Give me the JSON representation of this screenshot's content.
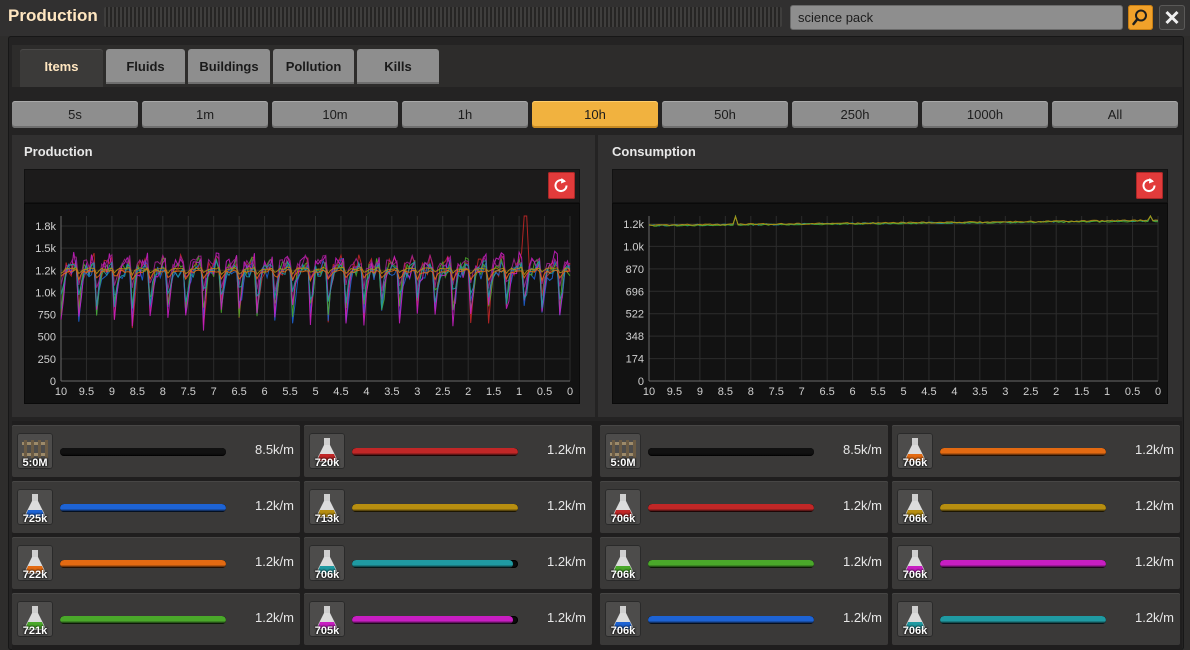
{
  "window": {
    "title": "Production"
  },
  "search": {
    "value": "science pack"
  },
  "tabs": [
    "Items",
    "Fluids",
    "Buildings",
    "Pollution",
    "Kills"
  ],
  "time_ranges": [
    "5s",
    "1m",
    "10m",
    "1h",
    "10h",
    "50h",
    "250h",
    "1000h",
    "All"
  ],
  "selected_time_range": "10h",
  "colors": {
    "accent": "#f1b23f",
    "reset": "#e23b3b",
    "series": [
      "#c12727",
      "#1d63d4",
      "#e36a12",
      "#4aa82a",
      "#a0208f",
      "#b78e10",
      "#1f9aa2",
      "#c81ec2",
      "#eeeeee"
    ]
  },
  "panels": {
    "production": {
      "title": "Production",
      "chart_data": {
        "type": "line",
        "title": "Production",
        "xlabel": "",
        "ylabel": "",
        "x_ticks": [
          "10",
          "9.5",
          "9",
          "8.5",
          "8",
          "7.5",
          "7",
          "6.5",
          "6",
          "5.5",
          "5",
          "4.5",
          "4",
          "3.5",
          "3",
          "2.5",
          "2",
          "1.5",
          "1",
          "0.5",
          "0"
        ],
        "y_ticks": [
          "0",
          "250",
          "500",
          "750",
          "1.0k",
          "1.2k",
          "1.5k",
          "1.8k"
        ],
        "ylim": [
          0,
          1750
        ],
        "xlim": [
          10,
          0
        ],
        "series": [
          {
            "color": "#c12727",
            "base": 1200,
            "amp": 550
          },
          {
            "color": "#1d63d4",
            "base": 1150,
            "amp": 500
          },
          {
            "color": "#4aa82a",
            "base": 1180,
            "amp": 480
          },
          {
            "color": "#c81ec2",
            "base": 1200,
            "amp": 600
          },
          {
            "color": "#a0208f",
            "base": 1250,
            "amp": 300
          },
          {
            "color": "#1f9aa2",
            "base": 1170,
            "amp": 380
          },
          {
            "color": "#e36a12",
            "base": 1160,
            "amp": 90
          },
          {
            "color": "#b78e10",
            "base": 1190,
            "amp": 60
          }
        ]
      }
    },
    "consumption": {
      "title": "Consumption",
      "chart_data": {
        "type": "line",
        "title": "Consumption",
        "xlabel": "",
        "ylabel": "",
        "x_ticks": [
          "10",
          "9.5",
          "9",
          "8.5",
          "8",
          "7.5",
          "7",
          "6.5",
          "6",
          "5.5",
          "5",
          "4.5",
          "4",
          "3.5",
          "3",
          "2.5",
          "2",
          "1.5",
          "1",
          "0.5",
          "0"
        ],
        "y_ticks": [
          "0",
          "174",
          "348",
          "522",
          "696",
          "870",
          "1.0k",
          "1.2k"
        ],
        "ylim": [
          0,
          1220
        ],
        "xlim": [
          10,
          0
        ],
        "series": [
          {
            "color": "#1f9aa2",
            "start": 1150,
            "end": 1185,
            "noise": 12
          },
          {
            "color": "#4aa82a",
            "start": 1148,
            "end": 1182,
            "noise": 10
          },
          {
            "color": "#b78e10",
            "start": 1152,
            "end": 1188,
            "noise": 10
          }
        ]
      }
    }
  },
  "production_rows": [
    {
      "icon": "rail-icon",
      "count": "5:0M",
      "color": "#111111",
      "fill": 1.0,
      "rate": "8.5k/m"
    },
    {
      "icon": "flask-icon",
      "count": "720k",
      "color": "#c12727",
      "fill": 1.0,
      "rate": "1.2k/m"
    },
    {
      "icon": "flask-icon",
      "count": "725k",
      "color": "#1d63d4",
      "fill": 1.0,
      "rate": "1.2k/m"
    },
    {
      "icon": "flask-icon",
      "count": "713k",
      "color": "#b78e10",
      "fill": 1.0,
      "rate": "1.2k/m"
    },
    {
      "icon": "flask-icon",
      "count": "722k",
      "color": "#e36a12",
      "fill": 1.0,
      "rate": "1.2k/m"
    },
    {
      "icon": "flask-icon",
      "count": "706k",
      "color": "#1f9aa2",
      "fill": 0.97,
      "rate": "1.2k/m"
    },
    {
      "icon": "flask-icon",
      "count": "721k",
      "color": "#4aa82a",
      "fill": 1.0,
      "rate": "1.2k/m"
    },
    {
      "icon": "flask-icon",
      "count": "705k",
      "color": "#c81ec2",
      "fill": 0.97,
      "rate": "1.2k/m"
    }
  ],
  "consumption_rows": [
    {
      "icon": "rail-icon",
      "count": "5:0M",
      "color": "#111111",
      "fill": 1.0,
      "rate": "8.5k/m"
    },
    {
      "icon": "flask-icon",
      "count": "706k",
      "color": "#e36a12",
      "fill": 1.0,
      "rate": "1.2k/m"
    },
    {
      "icon": "flask-icon",
      "count": "706k",
      "color": "#c12727",
      "fill": 1.0,
      "rate": "1.2k/m"
    },
    {
      "icon": "flask-icon",
      "count": "706k",
      "color": "#b78e10",
      "fill": 1.0,
      "rate": "1.2k/m"
    },
    {
      "icon": "flask-icon",
      "count": "706k",
      "color": "#4aa82a",
      "fill": 1.0,
      "rate": "1.2k/m"
    },
    {
      "icon": "flask-icon",
      "count": "706k",
      "color": "#c81ec2",
      "fill": 1.0,
      "rate": "1.2k/m"
    },
    {
      "icon": "flask-icon",
      "count": "706k",
      "color": "#1d63d4",
      "fill": 1.0,
      "rate": "1.2k/m"
    },
    {
      "icon": "flask-icon",
      "count": "706k",
      "color": "#1f9aa2",
      "fill": 1.0,
      "rate": "1.2k/m"
    }
  ]
}
